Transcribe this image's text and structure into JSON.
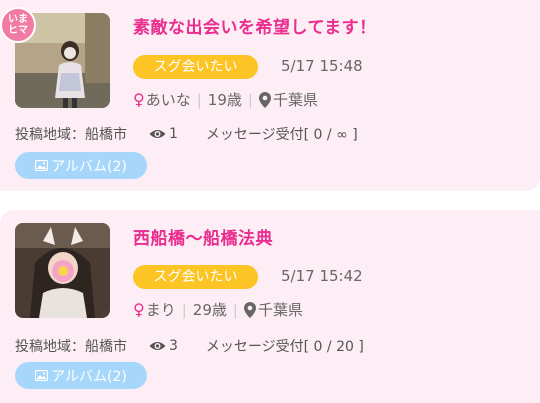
{
  "posts": [
    {
      "title": "素敵な出会いを希望してます！",
      "badge_line1": "いま",
      "badge_line2": "ヒマ",
      "status": "スグ会いたい",
      "time": "5/17 15:48",
      "gender_symbol": "♀",
      "name": "あいな",
      "age": "19歳",
      "prefecture": "千葉県",
      "area_label": "投稿地域：船橋市",
      "views": "1",
      "message_accept": "メッセージ受付[ 0 / ∞ ]",
      "album_label": "アルバム(2)"
    },
    {
      "title": "西船橋～船橋法典",
      "status": "スグ会いたい",
      "time": "5/17 15:42",
      "gender_symbol": "♀",
      "name": "まり",
      "age": "29歳",
      "prefecture": "千葉県",
      "area_label": "投稿地域：船橋市",
      "views": "3",
      "message_accept": "メッセージ受付[ 0 / 20 ]",
      "album_label": "アルバム(2)"
    }
  ],
  "icons": {
    "gender": "female-icon",
    "location": "map-pin-icon",
    "views": "eye-icon",
    "album": "image-icon"
  },
  "colors": {
    "card_bg": "#fdeef6",
    "title": "#ea2d8e",
    "status_pill": "#fcc425",
    "album_button": "#a6d7fb",
    "badge": "#f27ba6"
  }
}
